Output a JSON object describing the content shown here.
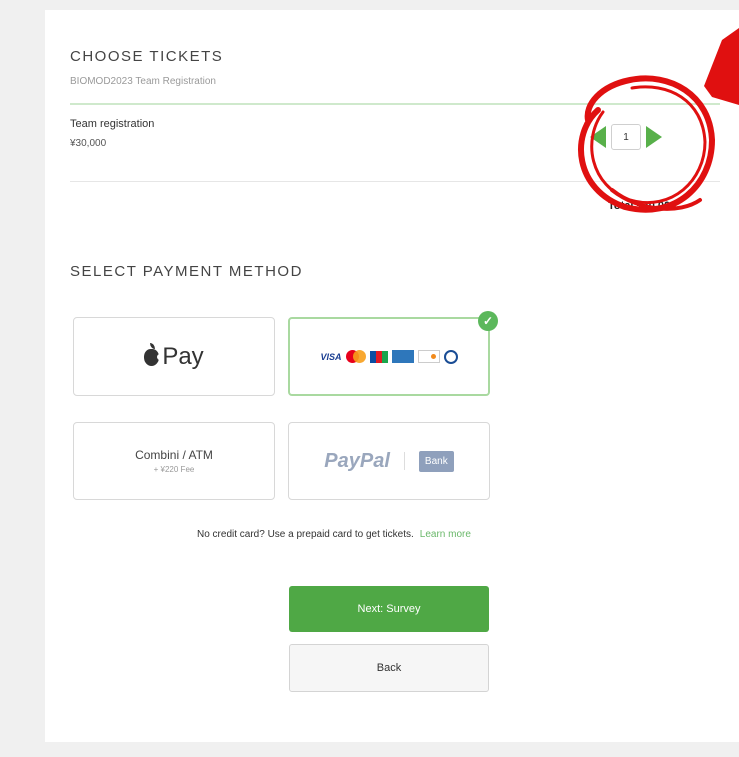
{
  "tickets": {
    "heading": "CHOOSE TICKETS",
    "event_name": "BIOMOD2023 Team Registration",
    "item": {
      "name": "Team registration",
      "price": "¥30,000",
      "quantity": "1"
    },
    "total_label": "Total ¥30,000"
  },
  "payment": {
    "heading": "SELECT PAYMENT METHOD",
    "methods": {
      "apple_pay": {
        "label": "Pay",
        "icon": "apple-icon"
      },
      "card": {
        "visa_label": "VISA",
        "selected": true,
        "badge_icon": "check-icon"
      },
      "konbini": {
        "title": "Combini / ATM",
        "fee": "+ ¥220 Fee"
      },
      "paypal": {
        "logo": "PayPal",
        "bank_label": "Bank"
      }
    }
  },
  "notice": {
    "text": "No credit card? Use a prepaid card to get tickets.",
    "link_text": "Learn more"
  },
  "actions": {
    "next_label": "Next: Survey",
    "back_label": "Back"
  },
  "colors": {
    "accent_green": "#4fa845",
    "annotation_red": "#e01010",
    "selected_border": "#a9d9a0"
  }
}
